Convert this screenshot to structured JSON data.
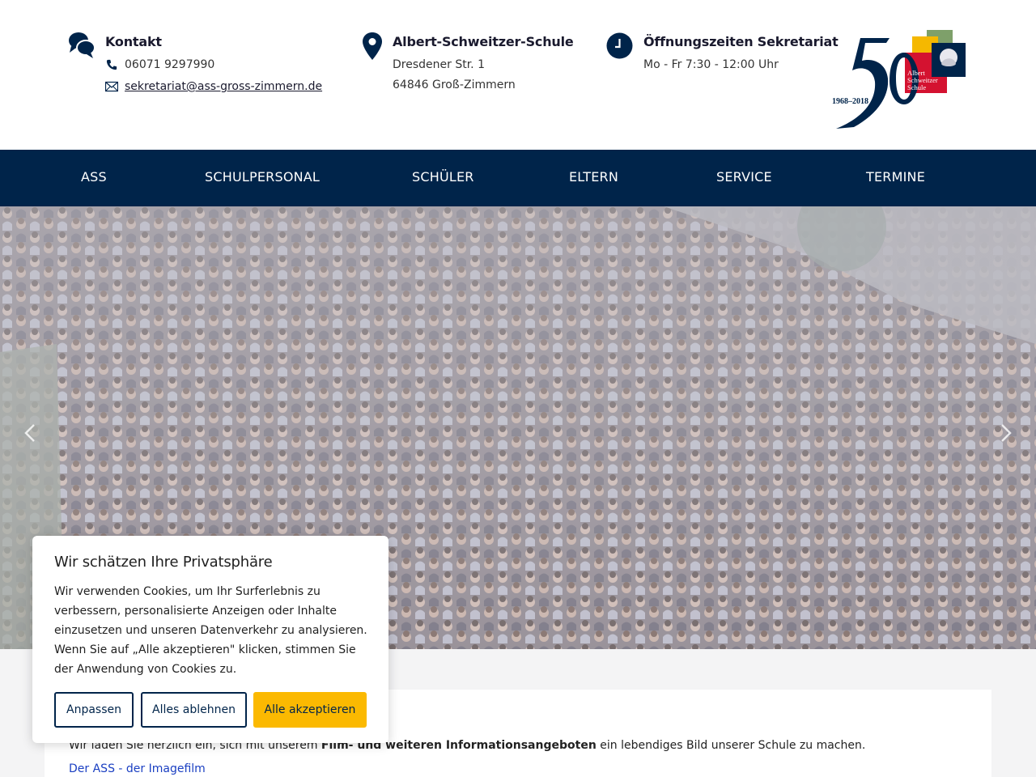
{
  "header": {
    "contact": {
      "title": "Kontakt",
      "phone": "06071 9297990",
      "email": "sekretariat@ass-gross-zimmern.de"
    },
    "school": {
      "title": "Albert-Schweitzer-Schule",
      "street": "Dresdener Str. 1",
      "city": "64846 Groß-Zimmern"
    },
    "hours": {
      "title": "Öffnungszeiten Sekretariat",
      "text": "Mo - Fr 7:30 - 12:00 Uhr"
    },
    "logo": {
      "years": "1968–2018",
      "line1": "Albert",
      "line2": "Schweitzer",
      "line3": "Schule"
    }
  },
  "nav": {
    "items": [
      {
        "label": "ASS"
      },
      {
        "label": "SCHULPERSONAL"
      },
      {
        "label": "SCHÜLER"
      },
      {
        "label": "ELTERN"
      },
      {
        "label": "SERVICE"
      },
      {
        "label": "TERMINE"
      }
    ]
  },
  "content": {
    "intro_start": "Wir laden Sie herzlich ein, sich mit unserem ",
    "intro_bold": "Film- und weiteren Informationsangeboten",
    "intro_end": " ein lebendiges Bild unserer Schule zu machen.",
    "link": "Der ASS - der Imagefilm"
  },
  "cookie": {
    "title": "Wir schätzen Ihre Privatsphäre",
    "text": "Wir verwenden Cookies, um Ihr Surferlebnis zu verbessern, personalisierte Anzeigen oder Inhalte einzusetzen und unseren Datenverkehr zu analysieren. Wenn Sie auf „Alle akzeptieren\" klicken, stimmen Sie der Anwendung von Cookies zu.",
    "btn_customize": "Anpassen",
    "btn_reject": "Alles ablehnen",
    "btn_accept": "Alle akzeptieren"
  },
  "colors": {
    "navy": "#00244a",
    "accent": "#fbb901",
    "link": "#1a3fc2"
  }
}
